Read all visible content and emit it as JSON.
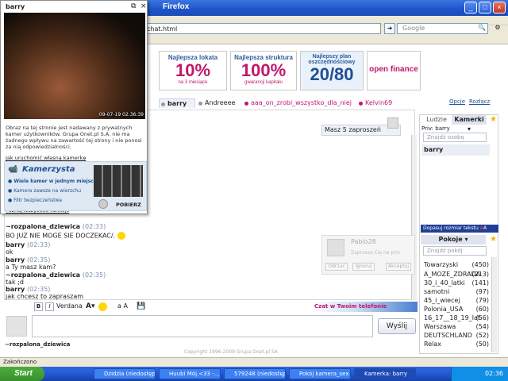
{
  "browser": {
    "title": "Firefox",
    "url": "chat.html",
    "search_placeholder": "Google",
    "status": "Zakończono"
  },
  "ads": [
    {
      "head": "Najlepsza lokata",
      "big": "10%",
      "small": "na 3 miesiące"
    },
    {
      "head": "Najlepsza struktura",
      "big": "100%",
      "small": "gwarancji kapitału"
    },
    {
      "head": "Najlepszy plan oszczędnościowy",
      "big": "20/80",
      "small": ""
    },
    {
      "head": "open finance",
      "big": "",
      "small": ""
    }
  ],
  "top_links": {
    "opcje": "Opcje",
    "rozlacz": "Rozłącz"
  },
  "tabs": [
    "barry",
    "Andreeee",
    "aaa_on_zrobi_wszystko_dla_niej",
    "Kelvin69"
  ],
  "invite": "Masz 5 zaproszeń",
  "messages": [
    {
      "nick": "~rozpalona_dziewica",
      "time": "(02:33)",
      "text": "BO JUZ NIE MOGE SIE DOCZEKAC/."
    },
    {
      "nick": "barry",
      "time": "(02:33)",
      "text": "ok"
    },
    {
      "nick": "barry",
      "time": "(02:35)",
      "text": "a Ty masz kam?"
    },
    {
      "nick": "~rozpalona_dziewica",
      "time": "(02:35)",
      "text": "tak ;d"
    },
    {
      "nick": "barry",
      "time": "(02:35)",
      "text": "jak chcesz to zapraszam"
    }
  ],
  "pablo": {
    "name": "Pablo28",
    "msg": "Zaprasza Cię na priv",
    "btns": [
      "Odrzuć",
      "Ignoruj",
      "Akceptuj"
    ]
  },
  "format": {
    "font": "Verdana",
    "promo": "Czat w Twoim telefonie"
  },
  "send": "Wyślij",
  "self_nick": "~rozpalona_dziewica",
  "copyright": "Copyright 1996-2009 Grupa Onet.pl SA",
  "right_panel": {
    "tab_ludzie": "Ludzie",
    "tab_kamerki": "Kamerki",
    "priv_label": "Priv: barry",
    "find_person": "Znajdź osobę",
    "person": "barry",
    "fit": "Dopasuj rozmiar tekstu",
    "rooms_tab": "Pokoje",
    "find_room": "Znajdź pokój",
    "rooms": [
      {
        "name": "Towarzyski",
        "count": "(450)"
      },
      {
        "name": "A_MOZE_ZDRADA",
        "count": "(213)"
      },
      {
        "name": "30_i_40_latki",
        "count": "(141)"
      },
      {
        "name": "samotni",
        "count": "(97)"
      },
      {
        "name": "45_i_wiecej",
        "count": "(79)"
      },
      {
        "name": "Polonia_USA",
        "count": "(60)"
      },
      {
        "name": "16_17__18_19_lat",
        "count": "(56)"
      },
      {
        "name": "Warszawa",
        "count": "(54)"
      },
      {
        "name": "DEUTSCHLAND",
        "count": "(52)"
      },
      {
        "name": "Relax",
        "count": "(50)"
      }
    ]
  },
  "popup": {
    "title": "barry",
    "timestamp": "09-07-19 02:36:39",
    "desc": "Obraz na tej stronie jest nadawany z prywatnych kamer użytkowników. Grupa Onet.pl S.A. nie ma żadnego wpływu na zawartość tej strony i nie ponosi za nią odpowiedzialności.",
    "own_cam": "Jak uruchomić własną kamerkę",
    "kam_title": "Kamerzysta",
    "features": [
      "Wiele kamer w jednym miejscu!",
      "Kamera zawsze na wierzchu",
      "Filtr bezpieczeństwa"
    ],
    "download": "POBIERZ",
    "all_features": "Poznaj wszystkie funkcje"
  },
  "taskbar": {
    "start": "Start",
    "tasks": [
      "Dzidzia (niedostępna...",
      "Huubi Mój.<33 -...",
      "579248 (niedostępny...",
      "Pokój kamera_sex Er...",
      "Kamerka: barry"
    ],
    "clock": "02:36"
  }
}
